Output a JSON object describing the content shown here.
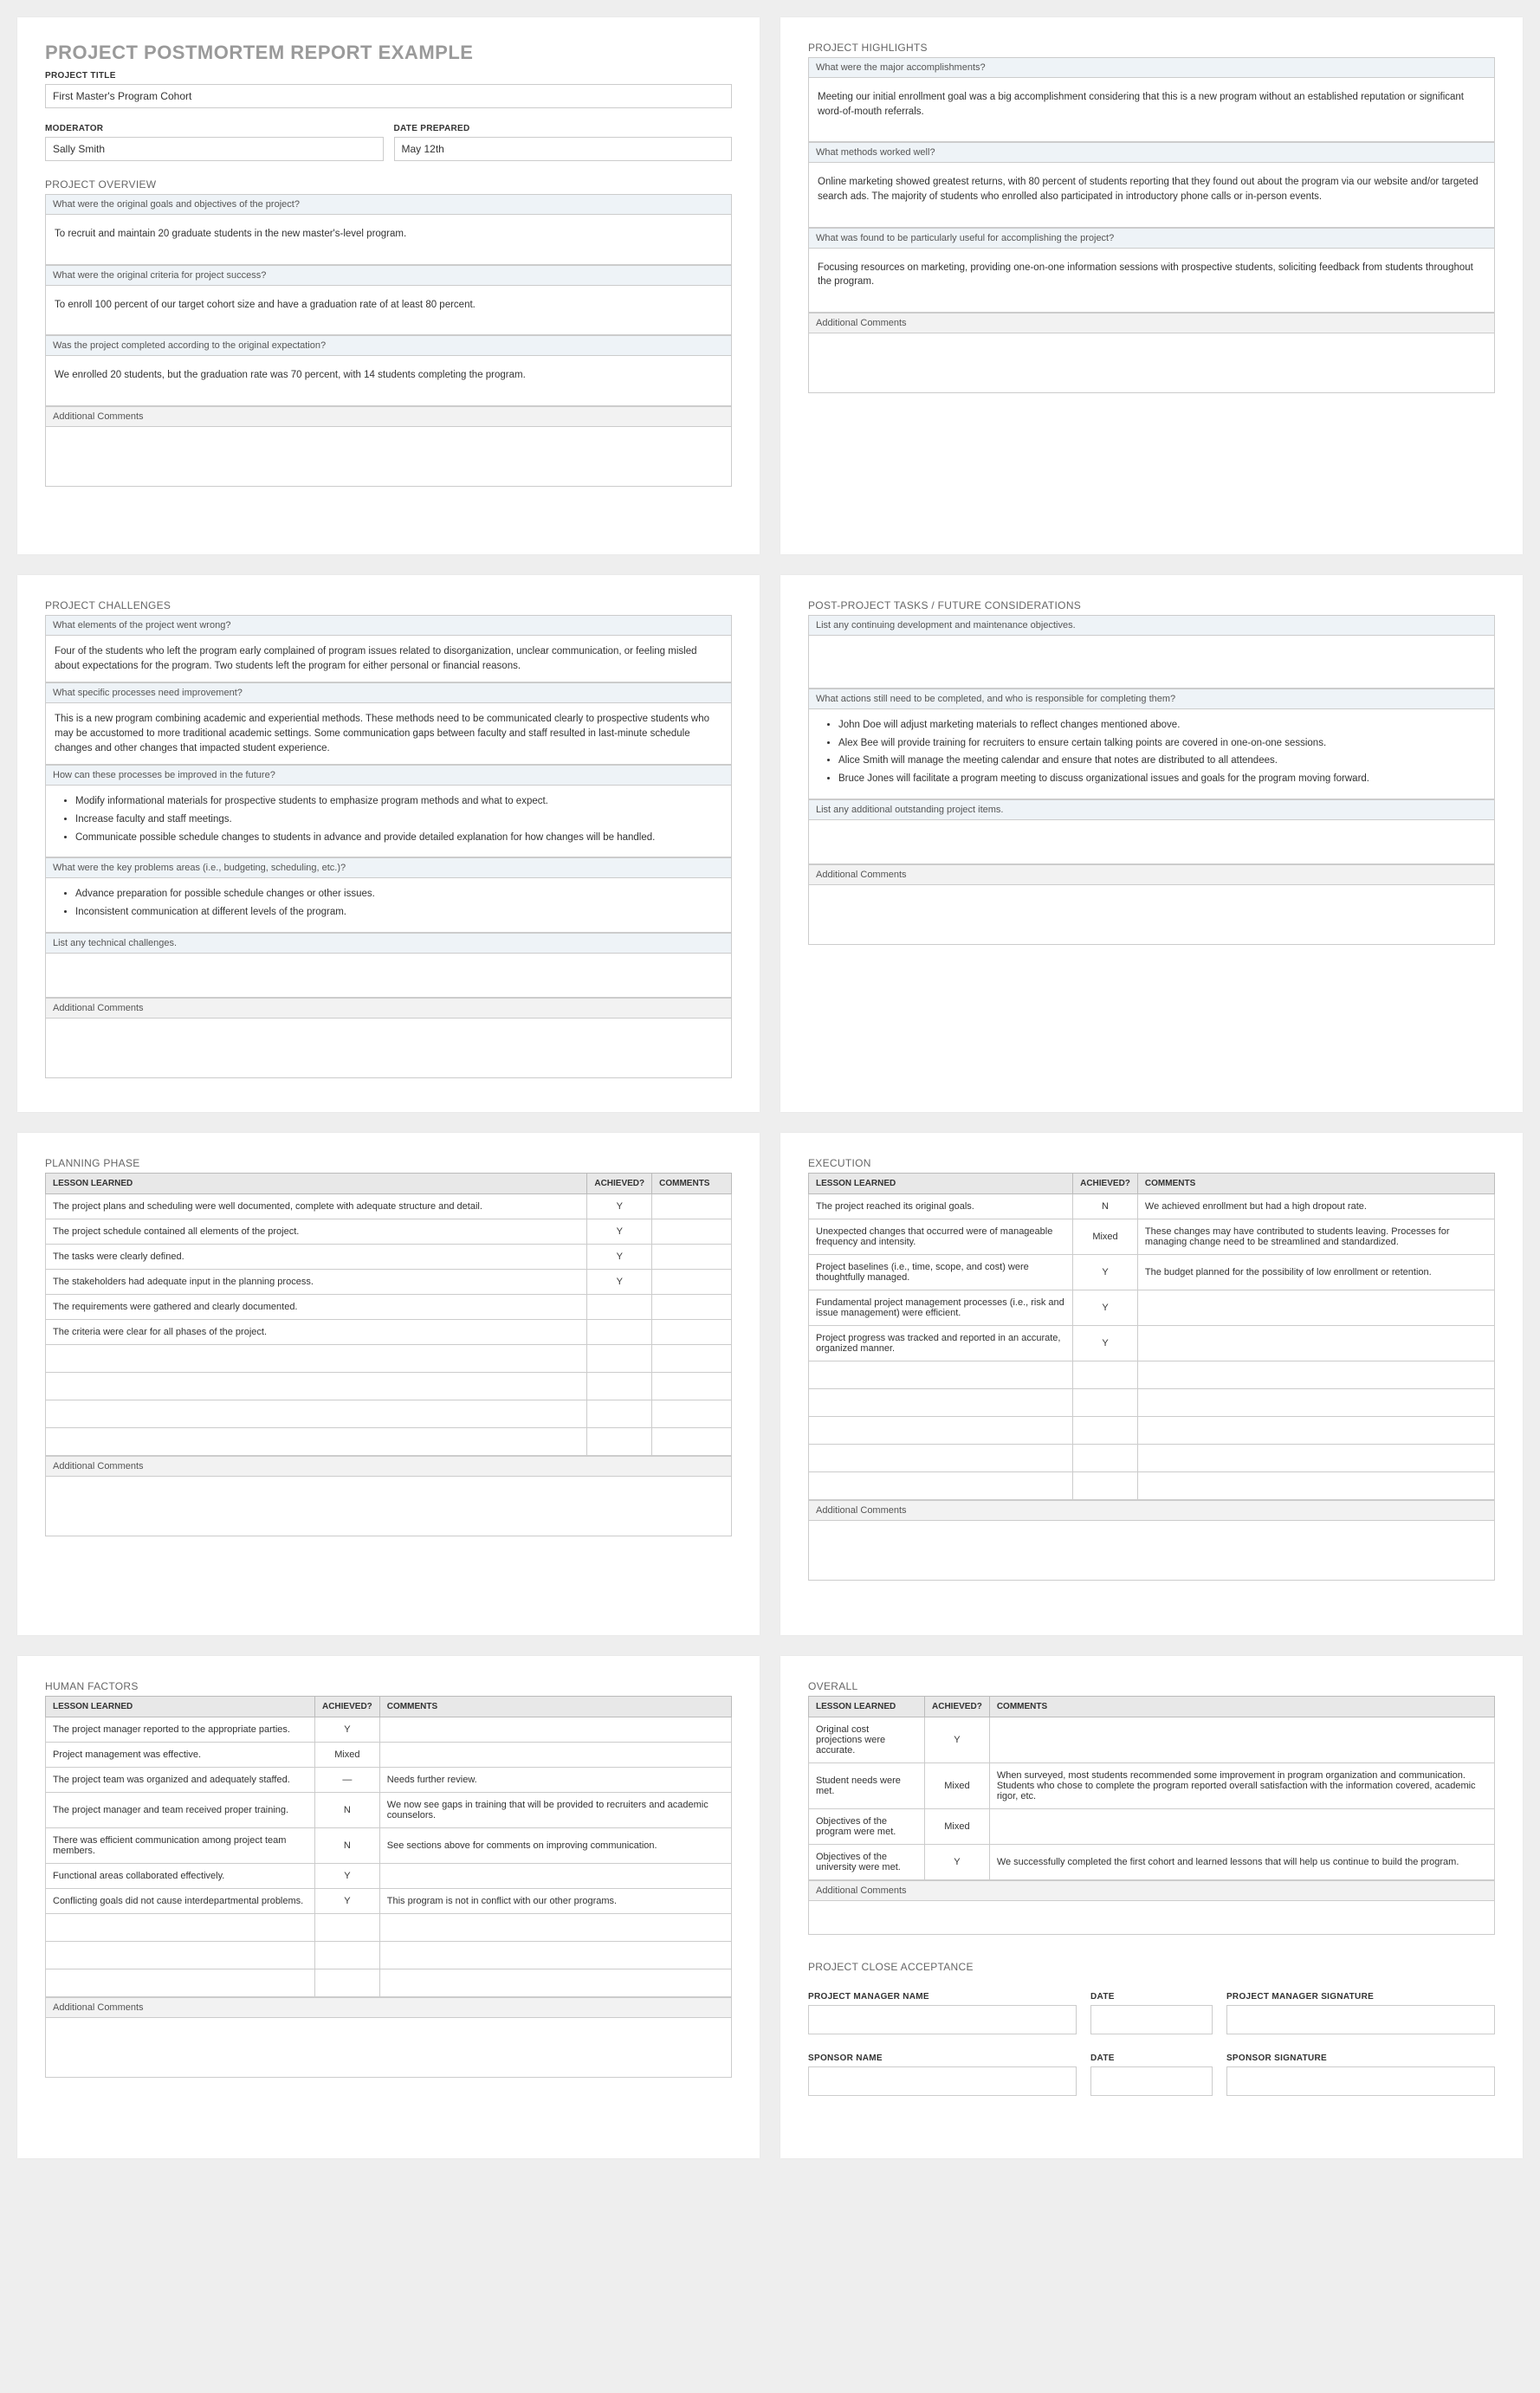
{
  "header": {
    "title": "PROJECT POSTMORTEM REPORT EXAMPLE",
    "project_title_label": "PROJECT TITLE",
    "project_title": "First Master's Program Cohort",
    "moderator_label": "MODERATOR",
    "moderator": "Sally Smith",
    "date_label": "DATE PREPARED",
    "date": "May 12th"
  },
  "overview": {
    "title": "PROJECT OVERVIEW",
    "q1": "What were the original goals and objectives of the project?",
    "a1": "To recruit and maintain 20 graduate students in the new master's-level program.",
    "q2": "What were the original criteria for project success?",
    "a2": "To enroll 100 percent of our target cohort size and have a graduation rate of at least 80 percent.",
    "q3": "Was the project completed according to the original expectation?",
    "a3": "We enrolled 20 students, but the graduation rate was 70 percent, with 14 students completing the program.",
    "add": "Additional Comments"
  },
  "highlights": {
    "title": "PROJECT HIGHLIGHTS",
    "q1": "What were the major accomplishments?",
    "a1": "Meeting our initial enrollment goal was a big accomplishment considering that this is a new program without an established reputation or significant word-of-mouth referrals.",
    "q2": "What methods worked well?",
    "a2": "Online marketing showed greatest returns, with 80 percent of students reporting that they found out about the program via our website and/or targeted search ads. The majority of students who enrolled also participated in introductory phone calls or in-person events.",
    "q3": "What was found to be particularly useful for accomplishing the project?",
    "a3": "Focusing resources on marketing, providing one-on-one information sessions with prospective students, soliciting feedback from students throughout the program.",
    "add": "Additional Comments"
  },
  "challenges": {
    "title": "PROJECT CHALLENGES",
    "q1": "What elements of the project went wrong?",
    "a1": "Four of the students who left the program early complained of program issues related to disorganization, unclear communication, or feeling misled  about expectations for the program. Two students left the program for either personal or financial reasons.",
    "q2": "What specific processes need improvement?",
    "a2": "This is a new program combining academic and experiential methods. These methods need to be communicated clearly to prospective students who may be accustomed to more traditional academic settings. Some communication gaps between faculty and staff resulted in last-minute schedule changes and other changes that impacted student experience.",
    "q3": "How can these processes be improved in the future?",
    "a3_list": [
      "Modify informational materials for prospective students to emphasize program methods and what to expect.",
      "Increase faculty and staff meetings.",
      "Communicate possible schedule changes to students in advance and provide detailed explanation for how changes will be handled."
    ],
    "q4": "What were the key problems areas (i.e., budgeting, scheduling, etc.)?",
    "a4_list": [
      "Advance preparation for possible schedule changes or other issues.",
      "Inconsistent communication at different levels of the program."
    ],
    "q5": "List any technical challenges.",
    "add": "Additional Comments"
  },
  "postproject": {
    "title": "POST-PROJECT TASKS / FUTURE CONSIDERATIONS",
    "q1": "List any continuing development and maintenance objectives.",
    "q2": "What actions still need to be completed, and who is responsible for completing them?",
    "a2_list": [
      "John Doe will adjust marketing materials to reflect changes mentioned above.",
      "Alex Bee will provide training for recruiters to ensure certain talking points are covered in one-on-one sessions.",
      "Alice Smith will manage the meeting calendar and ensure that notes are distributed to all attendees.",
      "Bruce Jones will facilitate a program meeting to discuss organizational issues and goals for the program moving forward."
    ],
    "q3": "List any additional outstanding project items.",
    "add": "Additional Comments"
  },
  "table_headers": {
    "lesson": "LESSON LEARNED",
    "achieved": "ACHIEVED?",
    "comments": "COMMENTS"
  },
  "planning": {
    "title": "PLANNING PHASE",
    "rows": [
      {
        "lesson": "The project plans and scheduling were well documented, complete with adequate structure and detail.",
        "ach": "Y",
        "c": ""
      },
      {
        "lesson": "The project schedule contained all elements of the project.",
        "ach": "Y",
        "c": ""
      },
      {
        "lesson": "The tasks were clearly defined.",
        "ach": "Y",
        "c": ""
      },
      {
        "lesson": "The stakeholders had adequate input in the planning process.",
        "ach": "Y",
        "c": ""
      },
      {
        "lesson": "The requirements were gathered and clearly documented.",
        "ach": "",
        "c": ""
      },
      {
        "lesson": "The criteria were clear for all phases of the project.",
        "ach": "",
        "c": ""
      }
    ],
    "empty_rows": 4,
    "add": "Additional Comments"
  },
  "execution": {
    "title": "EXECUTION",
    "rows": [
      {
        "lesson": "The project reached its original goals.",
        "ach": "N",
        "c": "We achieved enrollment but had a high dropout rate."
      },
      {
        "lesson": "Unexpected changes that occurred were of manageable frequency and intensity.",
        "ach": "Mixed",
        "c": "These changes may have contributed to students leaving. Processes for managing change need to be streamlined and standardized."
      },
      {
        "lesson": "Project baselines (i.e., time, scope, and cost) were thoughtfully managed.",
        "ach": "Y",
        "c": "The budget planned for the possibility of low enrollment or retention."
      },
      {
        "lesson": "Fundamental project management processes (i.e., risk and issue management) were efficient.",
        "ach": "Y",
        "c": ""
      },
      {
        "lesson": "Project progress was tracked and reported in an accurate, organized manner.",
        "ach": "Y",
        "c": ""
      }
    ],
    "empty_rows": 5,
    "add": "Additional Comments"
  },
  "human": {
    "title": "HUMAN FACTORS",
    "rows": [
      {
        "lesson": "The project manager reported to the appropriate parties.",
        "ach": "Y",
        "c": ""
      },
      {
        "lesson": "Project management was effective.",
        "ach": "Mixed",
        "c": ""
      },
      {
        "lesson": "The project team was organized and adequately staffed.",
        "ach": "—",
        "c": "Needs further review."
      },
      {
        "lesson": "The project manager and team received proper training.",
        "ach": "N",
        "c": "We now see gaps in training that will be provided to recruiters and academic counselors."
      },
      {
        "lesson": "There was efficient communication among project team members.",
        "ach": "N",
        "c": "See sections above for comments on improving communication."
      },
      {
        "lesson": "Functional areas collaborated effectively.",
        "ach": "Y",
        "c": ""
      },
      {
        "lesson": "Conflicting goals did not cause interdepartmental problems.",
        "ach": "Y",
        "c": "This program is not in conflict with our other programs."
      }
    ],
    "empty_rows": 3,
    "add": "Additional Comments"
  },
  "overall": {
    "title": "OVERALL",
    "rows": [
      {
        "lesson": "Original cost projections were accurate.",
        "ach": "Y",
        "c": ""
      },
      {
        "lesson": "Student needs were met.",
        "ach": "Mixed",
        "c": "When surveyed, most students recommended some improvement in program organization and communication. Students who chose to complete the program reported overall satisfaction with the information covered, academic rigor, etc."
      },
      {
        "lesson": "Objectives of the program were met.",
        "ach": "Mixed",
        "c": ""
      },
      {
        "lesson": "Objectives of the university were met.",
        "ach": "Y",
        "c": "We successfully completed the first cohort and learned lessons that will help us continue to build the program."
      }
    ],
    "empty_rows": 0,
    "add": "Additional Comments"
  },
  "close": {
    "title": "PROJECT CLOSE ACCEPTANCE",
    "pm_name": "PROJECT MANAGER NAME",
    "pm_sig": "PROJECT MANAGER SIGNATURE",
    "sp_name": "SPONSOR NAME",
    "sp_sig": "SPONSOR SIGNATURE",
    "date": "DATE"
  }
}
